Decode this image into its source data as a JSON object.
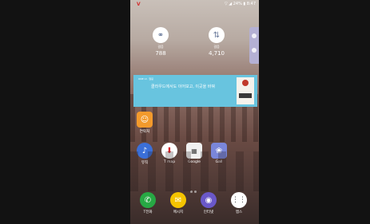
{
  "status_bar": {
    "carrier": "V",
    "right_text": "▽ ◢ 24% ▮ 8:47"
  },
  "widgets": [
    {
      "label": "걸음",
      "value": "788",
      "icon": "steps-icon"
    },
    {
      "label": "걸음",
      "value": "4,710",
      "icon": "sync-icon"
    }
  ],
  "banner": {
    "small_text": "ONE UI · 알림",
    "title": "클라우드에서도 이어보고, 이곳을 바꿔"
  },
  "apps_row1": [
    {
      "label": "연락처",
      "icon": "contacts-icon",
      "color": "#f39a2c"
    }
  ],
  "apps_row2": [
    {
      "label": "뮤직",
      "icon": "music-icon",
      "color": "#3b6fd8"
    },
    {
      "label": "T map",
      "icon": "tmap-icon",
      "color": "#ffffff"
    },
    {
      "label": "Google",
      "icon": "google-folder-icon",
      "color": "#f0f0f0"
    },
    {
      "label": "Gall",
      "icon": "gallery-icon",
      "color": "#7a86d9"
    }
  ],
  "dock": [
    {
      "label": "T전화",
      "icon": "phone-icon",
      "color": "#27a844"
    },
    {
      "label": "메시지",
      "icon": "message-icon",
      "color": "#f4c400"
    },
    {
      "label": "인터넷",
      "icon": "internet-icon",
      "color": "#6a58c9"
    },
    {
      "label": "앱스",
      "icon": "apps-icon",
      "color": "#ffffff"
    }
  ],
  "accent_colors": {
    "banner": "#68c4df",
    "side_panel": "#b4b0d4"
  }
}
